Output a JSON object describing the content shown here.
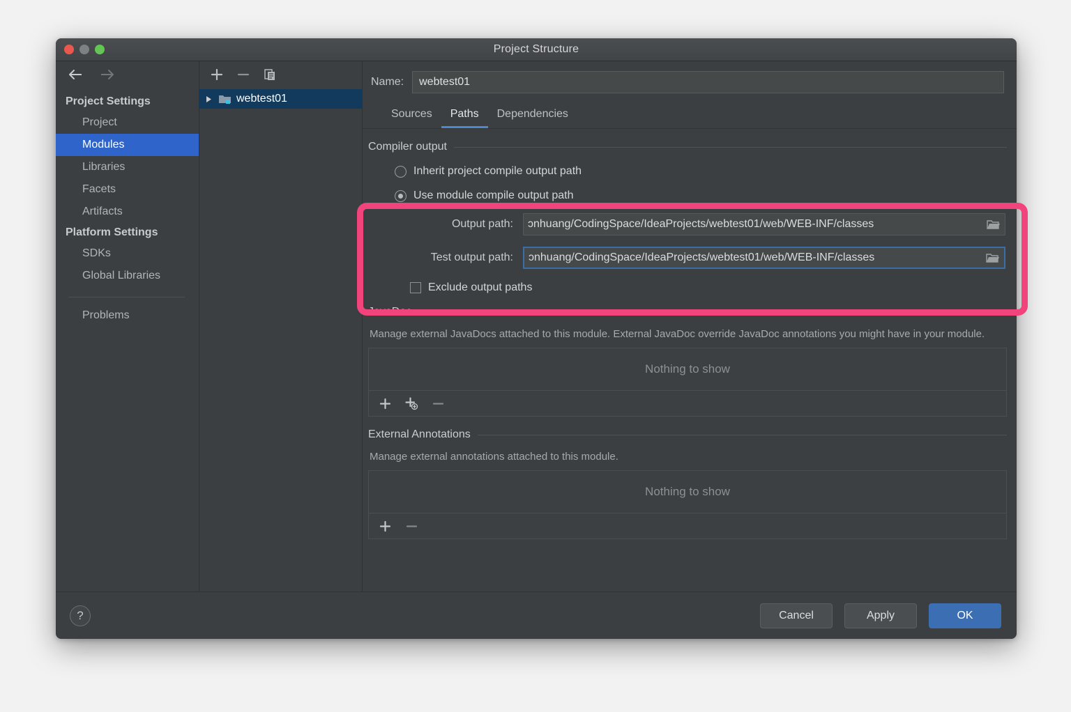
{
  "window": {
    "title": "Project Structure",
    "traffic_lights": [
      "close",
      "minimize",
      "zoom"
    ]
  },
  "nav": {
    "back_icon": "arrow-left-icon",
    "forward_icon": "arrow-right-icon"
  },
  "sidebar": {
    "groups": [
      {
        "label": "Project Settings",
        "items": [
          {
            "label": "Project",
            "selected": false
          },
          {
            "label": "Modules",
            "selected": true
          },
          {
            "label": "Libraries",
            "selected": false
          },
          {
            "label": "Facets",
            "selected": false
          },
          {
            "label": "Artifacts",
            "selected": false
          }
        ]
      },
      {
        "label": "Platform Settings",
        "items": [
          {
            "label": "SDKs",
            "selected": false
          },
          {
            "label": "Global Libraries",
            "selected": false
          }
        ]
      }
    ],
    "extra": {
      "label": "Problems"
    },
    "selection_color": "#2f65ca"
  },
  "modules_panel": {
    "toolbar": [
      {
        "name": "add-module-button",
        "icon": "plus-icon"
      },
      {
        "name": "remove-module-button",
        "icon": "minus-icon"
      },
      {
        "name": "copy-module-button",
        "icon": "copy-icon"
      }
    ],
    "tree": [
      {
        "label": "webtest01",
        "selected": true,
        "expander": "triangle-right-icon",
        "icon": "module-folder-icon"
      }
    ]
  },
  "main": {
    "name_label": "Name:",
    "name_value": "webtest01",
    "tabs": [
      {
        "label": "Sources",
        "active": false
      },
      {
        "label": "Paths",
        "active": true
      },
      {
        "label": "Dependencies",
        "active": false
      }
    ],
    "compiler_output": {
      "heading": "Compiler output",
      "options": [
        {
          "label": "Inherit project compile output path",
          "selected": false
        },
        {
          "label": "Use module compile output path",
          "selected": true
        }
      ],
      "fields": [
        {
          "label": "Output path:",
          "value": "ɔnhuang/CodingSpace/IdeaProjects/webtest01/web/WEB-INF/classes",
          "focused": false,
          "browse_icon": "folder-browse-icon"
        },
        {
          "label": "Test output path:",
          "value": "ɔnhuang/CodingSpace/IdeaProjects/webtest01/web/WEB-INF/classes",
          "focused": true,
          "browse_icon": "folder-browse-icon"
        }
      ],
      "checkbox": {
        "label": "Exclude output paths",
        "checked": false
      }
    },
    "javadoc": {
      "heading": "JavaDoc",
      "description": "Manage external JavaDocs attached to this module. External JavaDoc override JavaDoc annotations you might have in your module.",
      "empty_text": "Nothing to show",
      "toolbar": [
        {
          "name": "add-javadoc-button",
          "icon": "plus-icon"
        },
        {
          "name": "add-javadoc-url-button",
          "icon": "plus-globe-icon"
        },
        {
          "name": "remove-javadoc-button",
          "icon": "minus-icon"
        }
      ]
    },
    "external_annotations": {
      "heading": "External Annotations",
      "description": "Manage external annotations attached to this module.",
      "empty_text": "Nothing to show",
      "toolbar": [
        {
          "name": "add-annotation-button",
          "icon": "plus-icon"
        },
        {
          "name": "remove-annotation-button",
          "icon": "minus-icon"
        }
      ]
    }
  },
  "footer": {
    "help_label": "?",
    "cancel_label": "Cancel",
    "apply_label": "Apply",
    "ok_label": "OK",
    "primary_color": "#3c6eb4"
  },
  "annotation": {
    "highlight_color": "#f2447c",
    "shape": "rounded-rectangle"
  }
}
